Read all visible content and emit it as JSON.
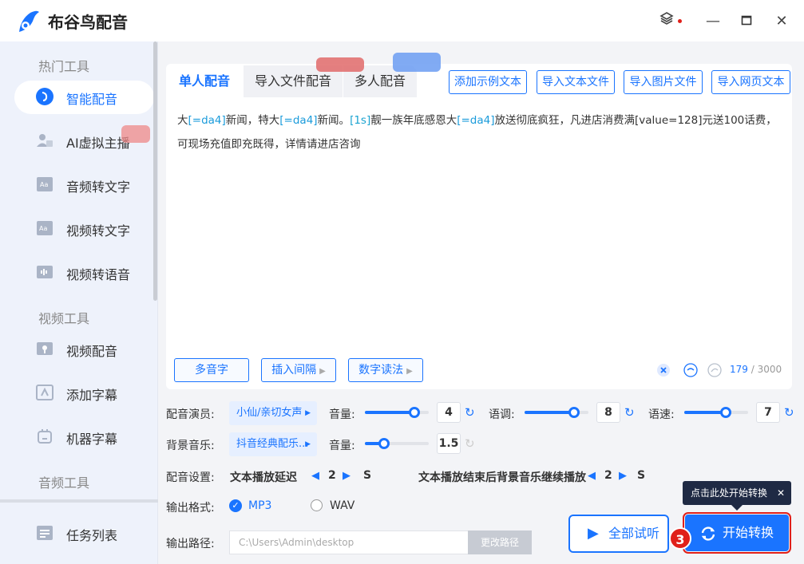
{
  "app": {
    "title": "布谷鸟配音",
    "icons": {
      "logo": "bird-logo-icon",
      "layers": "layers-icon",
      "minimize": "minimize-icon",
      "maximize": "maximize-icon",
      "close": "close-icon"
    }
  },
  "sidebar": {
    "sections": [
      {
        "title": "热门工具",
        "items": [
          {
            "label": "智能配音",
            "icon": "smart-dubbing-icon",
            "active": true
          },
          {
            "label": "AI虚拟主播",
            "icon": "virtual-anchor-icon"
          },
          {
            "label": "音频转文字",
            "icon": "audio-to-text-icon"
          },
          {
            "label": "视频转文字",
            "icon": "video-to-text-icon"
          },
          {
            "label": "视频转语音",
            "icon": "video-to-audio-icon"
          }
        ]
      },
      {
        "title": "视频工具",
        "items": [
          {
            "label": "视频配音",
            "icon": "video-dubbing-icon"
          },
          {
            "label": "添加字幕",
            "icon": "add-subtitle-icon"
          },
          {
            "label": "机器字幕",
            "icon": "robot-subtitle-icon"
          }
        ]
      },
      {
        "title": "音频工具",
        "items": []
      }
    ],
    "task_list": {
      "label": "任务列表",
      "icon": "task-list-icon"
    }
  },
  "tabs": [
    "单人配音",
    "导入文件配音",
    "多人配音"
  ],
  "top_buttons": [
    "添加示例文本",
    "导入文本文件",
    "导入图片文件",
    "导入网页文本"
  ],
  "editor": {
    "segments": [
      {
        "text": "大",
        "tag": false
      },
      {
        "text": "[=da4]",
        "tag": true
      },
      {
        "text": "新闻，特大",
        "tag": false
      },
      {
        "text": "[=da4]",
        "tag": true
      },
      {
        "text": "新闻。",
        "tag": false
      },
      {
        "text": "[1s]",
        "tag": true
      },
      {
        "text": "靓一族年底感恩大",
        "tag": false
      },
      {
        "text": "[=da4]",
        "tag": true
      },
      {
        "text": "放送彻底疯狂，凡进店消费满[value=128]元送100话费，",
        "tag": false
      }
    ],
    "line2": "可现场充值即充既得，详情请进店咨询",
    "buttons": [
      "多音字",
      "插入间隔",
      "数字读法"
    ],
    "count": "179",
    "max": "/ 3000"
  },
  "settings": {
    "voice_label": "配音演员:",
    "voice_value": "小仙/亲切女声",
    "volume_label": "音量:",
    "volume": "4",
    "volume_level": 0.78,
    "pitch_label": "语调:",
    "pitch": "8",
    "pitch_level": 0.78,
    "speed_label": "语速:",
    "speed": "7",
    "speed_level": 0.65,
    "bgm_label": "背景音乐:",
    "bgm_value": "抖音经典配乐...",
    "bgm_volume_label": "音量:",
    "bgm_volume": "1.5",
    "bgm_volume_level": 0.3,
    "dub_label": "配音设置:",
    "delay_label": "文本播放延迟",
    "delay": "2",
    "delay_unit": "S",
    "after_label": "文本播放结束后背景音乐继续播放",
    "after": "2",
    "after_unit": "S",
    "format_label": "输出格式:",
    "format_mp3": "MP3",
    "format_wav": "WAV",
    "path_label": "输出路径:",
    "path_value": "C:\\Users\\Admin\\desktop",
    "path_button": "更改路径"
  },
  "actions": {
    "preview": "全部试听",
    "convert": "开始转换",
    "tooltip": "点击此处开始转换",
    "step": "3"
  },
  "colors": {
    "accent": "#1a74ff",
    "highlight": "#e0201a"
  }
}
